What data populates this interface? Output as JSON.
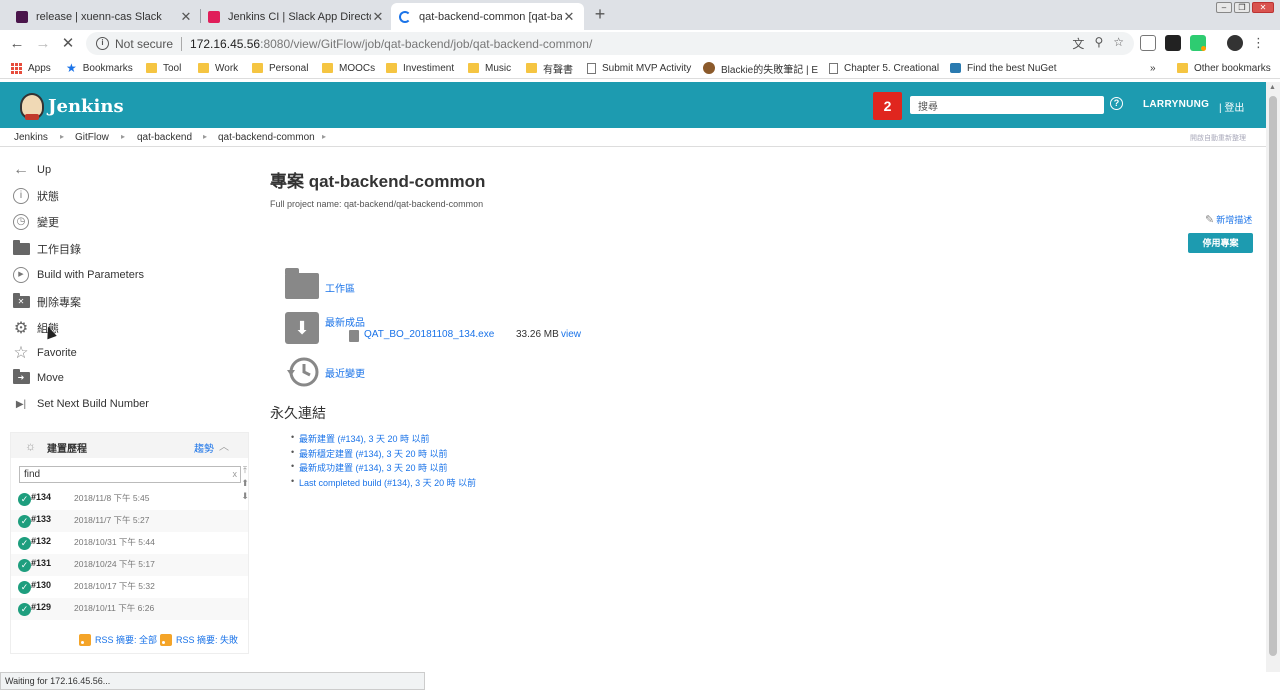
{
  "browser": {
    "tabs": [
      {
        "title": "release | xuenn-cas Slack",
        "fav_color": "#4a154b"
      },
      {
        "title": "Jenkins CI | Slack App Directory",
        "fav_color": "#e01e5a"
      },
      {
        "title": "qat-backend-common [qat-back",
        "fav_color": "#1a73e8"
      }
    ],
    "address": {
      "not_secure": "Not secure",
      "host": "172.16.45.56",
      "path": ":8080/view/GitFlow/job/qat-backend/job/qat-backend-common/"
    },
    "bookmarks": [
      {
        "label": "Apps",
        "icon": "apps-grid"
      },
      {
        "label": "Bookmarks",
        "icon": "star"
      },
      {
        "label": "Tool",
        "icon": "folder"
      },
      {
        "label": "Work",
        "icon": "folder"
      },
      {
        "label": "Personal",
        "icon": "folder"
      },
      {
        "label": "MOOCs",
        "icon": "folder"
      },
      {
        "label": "Investiment",
        "icon": "folder"
      },
      {
        "label": "Music",
        "icon": "folder"
      },
      {
        "label": "有聲書",
        "icon": "folder"
      },
      {
        "label": "Submit MVP Activity",
        "icon": "page"
      },
      {
        "label": "Blackie的失敗筆記 | E",
        "icon": "avatar"
      },
      {
        "label": "Chapter 5. Creational",
        "icon": "page"
      },
      {
        "label": "Find the best NuGet",
        "icon": "nuget"
      },
      {
        "label": "»",
        "icon": "none"
      },
      {
        "label": "Other bookmarks",
        "icon": "folder"
      }
    ],
    "status": "Waiting for 172.16.45.56..."
  },
  "jenkins": {
    "brand": "Jenkins",
    "notification_count": "2",
    "search_placeholder": "搜尋",
    "user": "LARRYNUNG",
    "logout": "| 登出",
    "breadcrumbs": [
      "Jenkins",
      "GitFlow",
      "qat-backend",
      "qat-backend-common"
    ],
    "auto_refresh": "開啟自動重新整理",
    "tasks": [
      {
        "label": "Up",
        "icon": "arrow-left-icon"
      },
      {
        "label": "狀態",
        "icon": "info-icon"
      },
      {
        "label": "變更",
        "icon": "history-icon"
      },
      {
        "label": "工作目錄",
        "icon": "folder-icon"
      },
      {
        "label": "Build with Parameters",
        "icon": "play-icon"
      },
      {
        "label": "刪除專案",
        "icon": "delete-folder-icon"
      },
      {
        "label": "組態",
        "icon": "gear-icon"
      },
      {
        "label": "Favorite",
        "icon": "star-icon"
      },
      {
        "label": "Move",
        "icon": "move-folder-icon"
      },
      {
        "label": "Set Next Build Number",
        "icon": "next-number-icon"
      }
    ],
    "build_history": {
      "title": "建置歷程",
      "trend": "趨勢",
      "find_value": "find",
      "builds": [
        {
          "number": "#134",
          "date": "2018/11/8 下午 5:45"
        },
        {
          "number": "#133",
          "date": "2018/11/7 下午 5:27"
        },
        {
          "number": "#132",
          "date": "2018/10/31 下午 5:44"
        },
        {
          "number": "#131",
          "date": "2018/10/24 下午 5:17"
        },
        {
          "number": "#130",
          "date": "2018/10/17 下午 5:32"
        },
        {
          "number": "#129",
          "date": "2018/10/11 下午 6:26"
        }
      ],
      "rss_all": "RSS 摘要: 全部",
      "rss_fail": "RSS 摘要: 失敗"
    },
    "main": {
      "title": "專案 qat-backend-common",
      "full_name": "Full project name: qat-backend/qat-backend-common",
      "add_description": "新增描述",
      "disable_button": "停用專案",
      "workspace": "工作區",
      "last_artifacts": "最新成品",
      "artifact": {
        "name": "QAT_BO_20181108_134.exe",
        "size": "33.26 MB",
        "view": "view"
      },
      "recent_changes": "最近變更",
      "permalinks_title": "永久連結",
      "permalinks": [
        "最新建置 (#134), 3 天 20 時 以前",
        "最新穩定建置 (#134), 3 天 20 時 以前",
        "最新成功建置 (#134), 3 天 20 時 以前",
        "Last completed build (#134), 3 天 20 時 以前"
      ]
    }
  }
}
